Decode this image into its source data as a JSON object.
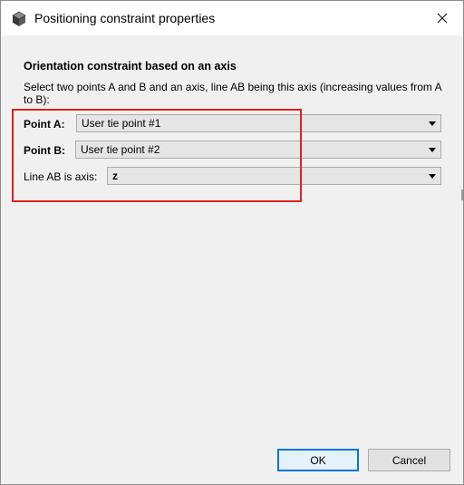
{
  "window": {
    "title": "Positioning constraint properties",
    "app_icon": "cube-icon",
    "close_icon": "close-icon"
  },
  "content": {
    "heading": "Orientation constraint based on an axis",
    "description": "Select two points A and B and an axis, line AB being this axis (increasing values from A to B):"
  },
  "fields": {
    "point_a": {
      "label": "Point A:",
      "value": "User tie point #1"
    },
    "point_b": {
      "label": "Point B:",
      "value": "User tie point #2"
    },
    "axis": {
      "label": "Line AB is axis:",
      "value": "z"
    }
  },
  "buttons": {
    "ok": "OK",
    "cancel": "Cancel"
  },
  "colors": {
    "highlight": "#e02020",
    "default_button_border": "#0078d7"
  }
}
